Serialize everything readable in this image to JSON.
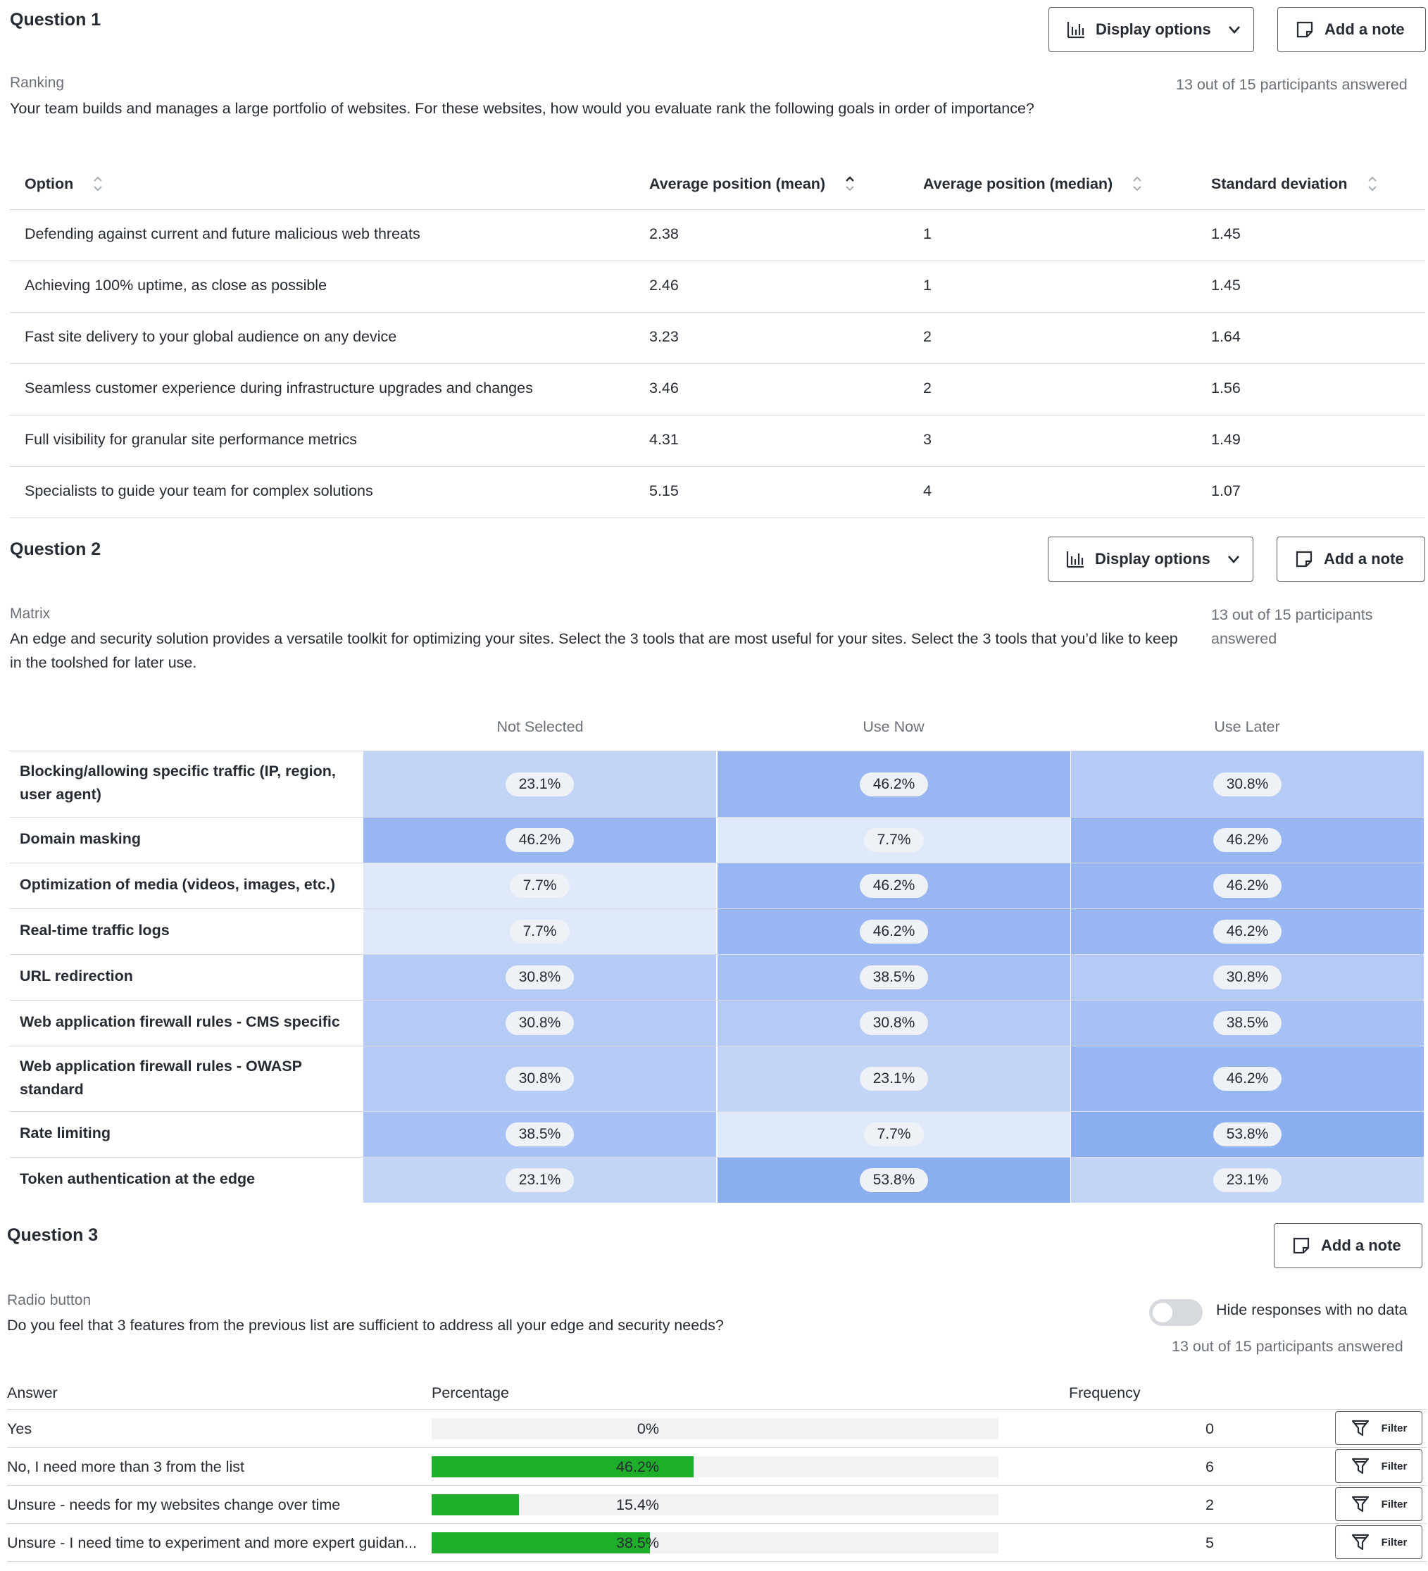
{
  "q1": {
    "title": "Question 1",
    "display_options": "Display options",
    "add_note": "Add a note",
    "type": "Ranking",
    "text": "Your team builds and manages a large portfolio of websites. For these websites, how would you evaluate rank the following goals in order of importance?",
    "answered": "13 out of 15 participants answered",
    "headers": [
      "Option",
      "Average position (mean)",
      "Average position (median)",
      "Standard deviation"
    ],
    "rows": [
      [
        "Defending against current and future malicious web threats",
        "2.38",
        "1",
        "1.45"
      ],
      [
        "Achieving 100% uptime, as close as possible",
        "2.46",
        "1",
        "1.45"
      ],
      [
        "Fast site delivery to your global audience on any device",
        "3.23",
        "2",
        "1.64"
      ],
      [
        "Seamless customer experience during infrastructure upgrades and changes",
        "3.46",
        "2",
        "1.56"
      ],
      [
        "Full visibility for granular site performance metrics",
        "4.31",
        "3",
        "1.49"
      ],
      [
        "Specialists to guide your team for complex solutions",
        "5.15",
        "4",
        "1.07"
      ]
    ]
  },
  "q2": {
    "title": "Question 2",
    "display_options": "Display options",
    "add_note": "Add a note",
    "type": "Matrix",
    "text": "An edge and security solution provides a versatile toolkit for optimizing your sites. Select the 3 tools that are most useful for your sites. Select the 3 tools that you’d like to keep in the toolshed for later use.",
    "answered": "13 out of 15 participants answered",
    "columns": [
      "Not Selected",
      "Use Now",
      "Use Later"
    ],
    "rows": [
      {
        "label": "Blocking/allowing specific traffic (IP, region, user agent)",
        "values": [
          "23.1%",
          "46.2%",
          "30.8%"
        ]
      },
      {
        "label": "Domain masking",
        "values": [
          "46.2%",
          "7.7%",
          "46.2%"
        ]
      },
      {
        "label": "Optimization of media (videos, images, etc.)",
        "values": [
          "7.7%",
          "46.2%",
          "46.2%"
        ]
      },
      {
        "label": "Real-time traffic logs",
        "values": [
          "7.7%",
          "46.2%",
          "46.2%"
        ]
      },
      {
        "label": "URL redirection",
        "values": [
          "30.8%",
          "38.5%",
          "30.8%"
        ]
      },
      {
        "label": "Web application firewall rules - CMS specific",
        "values": [
          "30.8%",
          "30.8%",
          "38.5%"
        ]
      },
      {
        "label": "Web application firewall rules - OWASP standard",
        "values": [
          "30.8%",
          "23.1%",
          "46.2%"
        ]
      },
      {
        "label": "Rate limiting",
        "values": [
          "38.5%",
          "7.7%",
          "53.8%"
        ]
      },
      {
        "label": "Token authentication at the edge",
        "values": [
          "23.1%",
          "53.8%",
          "23.1%"
        ]
      }
    ]
  },
  "q3": {
    "title": "Question 3",
    "add_note": "Add a note",
    "type": "Radio button",
    "text": "Do you feel that 3 features from the previous list are sufficient to address all your edge and security needs?",
    "toggle_label": "Hide responses with no data",
    "toggle_on": false,
    "answered": "13 out of 15 participants answered",
    "headers": {
      "answer": "Answer",
      "percentage": "Percentage",
      "frequency": "Frequency"
    },
    "filter_label": "Filter",
    "bar_color": "#1fae2a",
    "rows": [
      {
        "answer": "Yes",
        "fraction": 0.0,
        "percent": "0%",
        "count": "0"
      },
      {
        "answer": "No, I need more than 3 from the list",
        "fraction": 0.462,
        "percent": "46.2%",
        "count": "6"
      },
      {
        "answer": "Unsure - needs for my websites change over time",
        "fraction": 0.154,
        "percent": "15.4%",
        "count": "2"
      },
      {
        "answer": "Unsure - I need time to experiment and more expert guidan...",
        "fraction": 0.385,
        "percent": "38.5%",
        "count": "5"
      }
    ]
  }
}
